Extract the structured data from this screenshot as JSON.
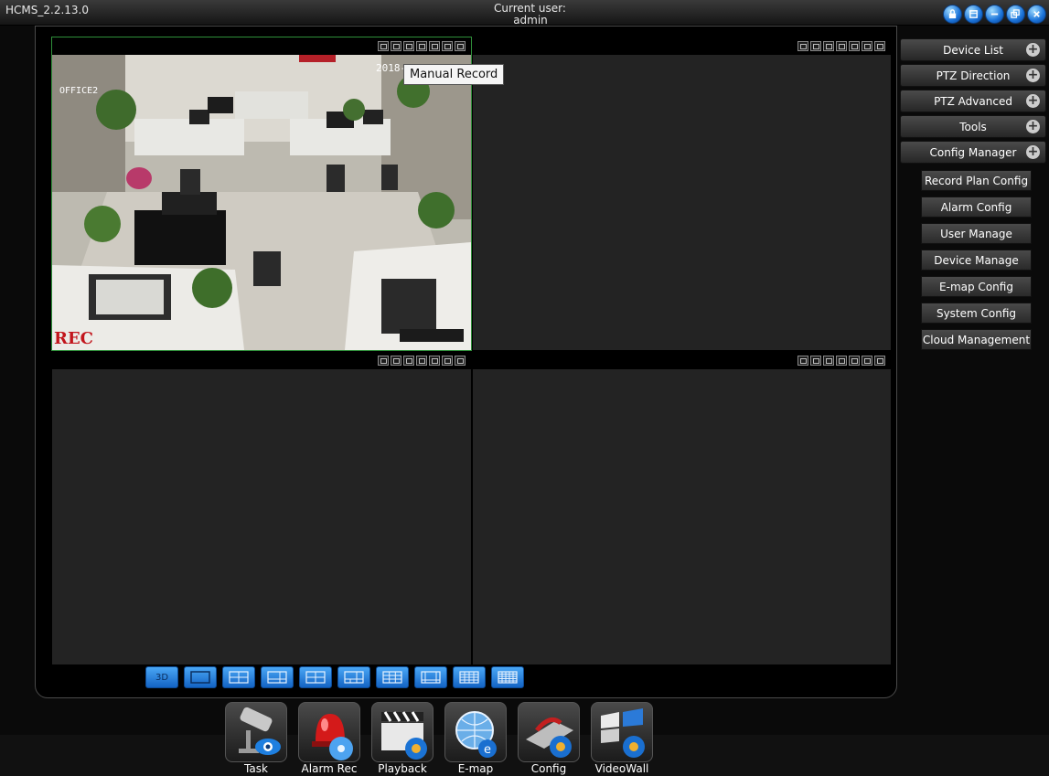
{
  "app": {
    "title": "HCMS_2.2.13.0"
  },
  "header": {
    "user_label": "Current user:",
    "user_name": "admin"
  },
  "window_controls": [
    {
      "name": "lock-icon"
    },
    {
      "name": "restore-icon"
    },
    {
      "name": "minimize-icon"
    },
    {
      "name": "maximize-icon"
    },
    {
      "name": "close-icon"
    }
  ],
  "video": {
    "active_cell": 1,
    "cell1": {
      "osd_name": "OFFICE2",
      "osd_date": "2018-",
      "rec": "REC"
    },
    "tooltip": "Manual Record",
    "cell_toolbar_icons": [
      "capture-icon",
      "split-icon",
      "record-icon",
      "talk-icon",
      "zoom-icon",
      "audio-icon",
      "close-icon"
    ]
  },
  "layout_buttons": [
    "3D",
    "1x1",
    "2x2",
    "1+3",
    "2x2 wide",
    "1+5",
    "3x3",
    "1+7",
    "4x4",
    "5x5"
  ],
  "right_panel": {
    "menus": [
      {
        "label": "Device List"
      },
      {
        "label": "PTZ Direction"
      },
      {
        "label": "PTZ Advanced"
      },
      {
        "label": "Tools"
      },
      {
        "label": "Config Manager"
      }
    ],
    "config_items": [
      {
        "label": "Record Plan Config"
      },
      {
        "label": "Alarm Config"
      },
      {
        "label": "User Manage"
      },
      {
        "label": "Device Manage"
      },
      {
        "label": "E-map Config"
      },
      {
        "label": "System Config"
      },
      {
        "label": "Cloud Management"
      }
    ]
  },
  "dock": [
    {
      "label": "Task",
      "icon": "camera-eye-icon"
    },
    {
      "label": "Alarm Rec",
      "icon": "alarm-siren-icon"
    },
    {
      "label": "Playback",
      "icon": "clapperboard-icon"
    },
    {
      "label": "E-map",
      "icon": "globe-map-icon"
    },
    {
      "label": "Config",
      "icon": "config-gear-icon"
    },
    {
      "label": "VideoWall",
      "icon": "videowall-icon"
    }
  ]
}
